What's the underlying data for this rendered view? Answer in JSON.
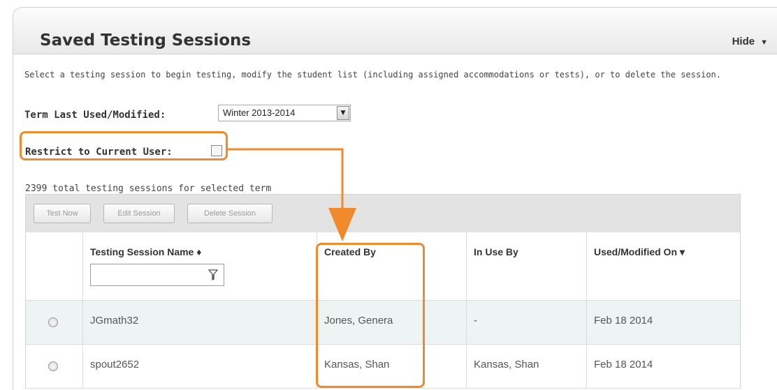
{
  "panel": {
    "title": "Saved Testing Sessions",
    "hide_label": "Hide",
    "description": "Select a testing session to begin testing, modify the student list (including assigned accommodations or tests), or to delete the session."
  },
  "term": {
    "label": "Term Last Used/Modified:",
    "selected": "Winter 2013-2014"
  },
  "restrict": {
    "label": "Restrict to Current User:",
    "checked": false
  },
  "total_text": "2399 total testing sessions for selected term",
  "toolbar": {
    "test_now": "Test Now",
    "edit_session": "Edit Session",
    "delete_session": "Delete Session"
  },
  "table": {
    "columns": {
      "name": "Testing Session Name ♦",
      "created_by": "Created By",
      "in_use_by": "In Use By",
      "modified_on": "Used/Modified On ▾"
    },
    "filter_placeholder": "",
    "rows": [
      {
        "name": "JGmath32",
        "created_by": "Jones, Genera",
        "in_use_by": "-",
        "modified_on": "Feb 18 2014"
      },
      {
        "name": "spout2652",
        "created_by": "Kansas, Shan",
        "in_use_by": "Kansas, Shan",
        "modified_on": "Feb 18 2014"
      }
    ]
  },
  "colors": {
    "highlight": "#f08a2a",
    "toolbar_bg": "#e3e3e3",
    "alt_row": "#eef4f4"
  }
}
